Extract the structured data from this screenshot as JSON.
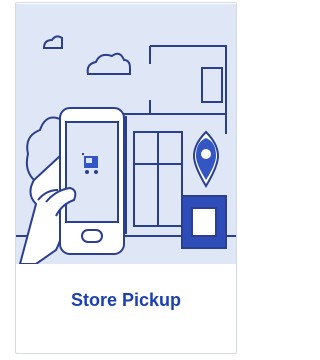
{
  "card": {
    "title": "Store Pickup"
  },
  "icons": {
    "phone_icon": "shopping-cart-icon",
    "pin_icon": "location-pin-icon",
    "clouds": "cloud-icon"
  },
  "colors": {
    "title": "#1b40b3",
    "illustration_bg": "#dfe7f6",
    "line": "#2a3f8f",
    "accent": "#3356c4"
  }
}
